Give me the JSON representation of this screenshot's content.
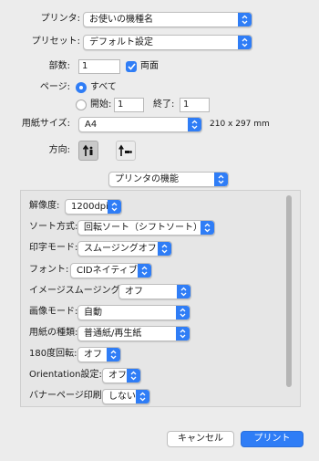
{
  "printer": {
    "label": "プリンタ:",
    "value": "お使いの機種名"
  },
  "preset": {
    "label": "プリセット:",
    "value": "デフォルト設定"
  },
  "copies": {
    "label": "部数:",
    "value": "1",
    "duplex_label": "両面",
    "duplex_checked": true
  },
  "pages": {
    "label": "ページ:",
    "all_label": "すべて",
    "from_label": "開始:",
    "from_value": "1",
    "to_label": "終了:",
    "to_value": "1",
    "selected": "all"
  },
  "paper_size": {
    "label": "用紙サイズ:",
    "value": "A4",
    "dimensions": "210 x 297 mm"
  },
  "orientation": {
    "label": "方向:",
    "selected": "portrait"
  },
  "section_popup": {
    "value": "プリンタの機能"
  },
  "features": [
    {
      "label": "解像度:",
      "value": "1200dpi"
    },
    {
      "label": "ソート方式:",
      "value": "回転ソート（シフトソート）"
    },
    {
      "label": "印字モード:",
      "value": "スムージングオフ"
    },
    {
      "label": "フォント:",
      "value": "CIDネイティブ"
    },
    {
      "label": "イメージスムージング:",
      "value": "オフ"
    },
    {
      "label": "画像モード:",
      "value": "自動"
    },
    {
      "label": "用紙の種類:",
      "value": "普通紙/再生紙"
    },
    {
      "label": "180度回転:",
      "value": "オフ"
    },
    {
      "label": "Orientation設定:",
      "value": "オフ"
    },
    {
      "label": "バナーページ印刷:",
      "value": "しない"
    }
  ],
  "buttons": {
    "cancel": "キャンセル",
    "print": "プリント"
  },
  "colors": {
    "accent": "#2f7df6",
    "background": "#ececec"
  }
}
